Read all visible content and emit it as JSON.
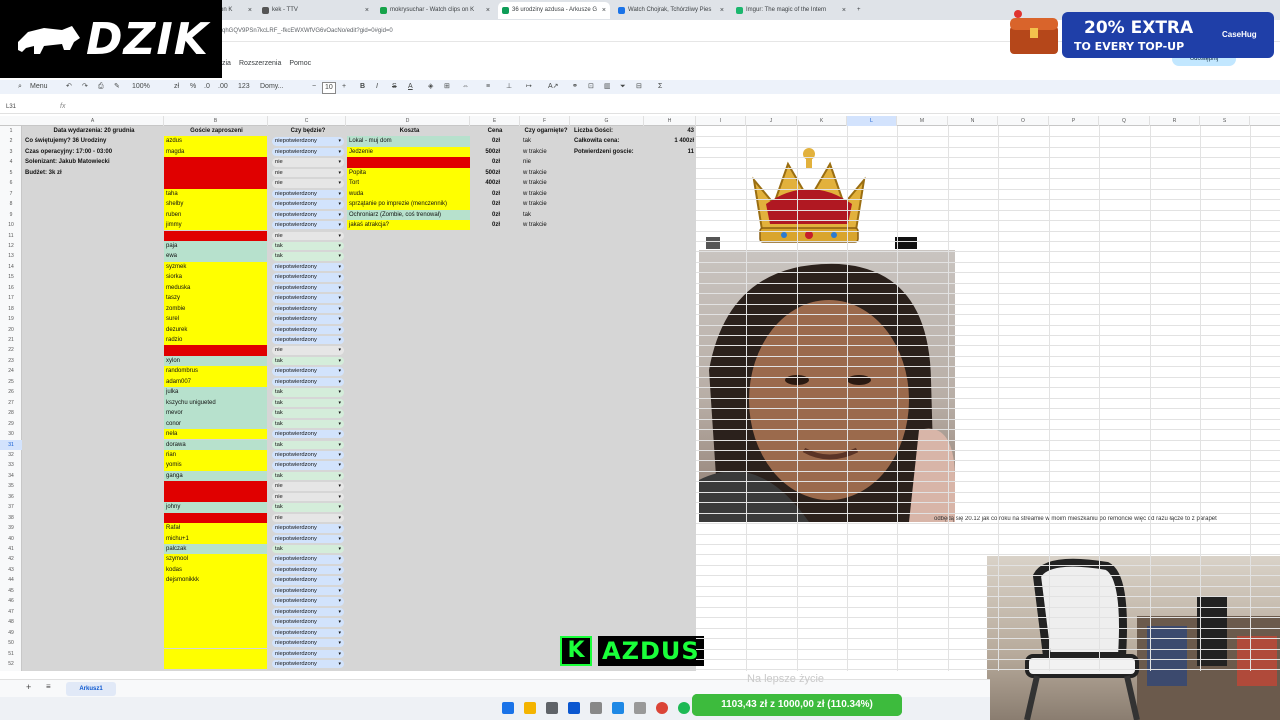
{
  "browser": {
    "tabs": [
      {
        "label": "on K",
        "color": "#888888"
      },
      {
        "label": "kek - TTV",
        "color": "#555555"
      },
      {
        "label": "mokrysuchar - Watch clips on K",
        "color": "#16a34a"
      },
      {
        "label": "36 urodziny azdusa - Arkusze G",
        "color": "#0f9d58",
        "active": true
      },
      {
        "label": "Watch Chojrak, Tchórzliwy Pies",
        "color": "#1a73e8"
      },
      {
        "label": "Imgur: The magic of the Intern",
        "color": "#1bb76e"
      }
    ],
    "new_tab": "+",
    "url": "qhGQV9PSn7kcLRF_-fkcEWXWfVG6vOacNo/edit?gid=0#gid=0"
  },
  "docs": {
    "menus": [
      "zia",
      "Rozszerzenia",
      "Pomoc"
    ],
    "share_label": "Udostępnij"
  },
  "toolbar": {
    "menu_label": "Menu",
    "zoom": "100%",
    "currency": "zł",
    "percent": "%",
    "dec_dec": ".0",
    "dec_inc": ".00",
    "number_fmt": "123",
    "font": "Domy...",
    "font_size": "10"
  },
  "formula": {
    "namebox": "L31",
    "fx": "fx"
  },
  "columns": [
    "A",
    "B",
    "C",
    "D",
    "E",
    "F",
    "G",
    "H",
    "I",
    "J",
    "K",
    "L",
    "M",
    "N",
    "O",
    "P",
    "Q",
    "R",
    "S"
  ],
  "selected_column": "L",
  "selected_row": 31,
  "row_count": 52,
  "headers": {
    "date": "Data wydarzenia: 20 grudnia",
    "guests": "Goście zaproszeni",
    "coming": "Czy będzie?",
    "costs": "Koszta",
    "price": "Cena",
    "handled": "Czy ogarnięte?",
    "guest_count_label": "Liczba Gości:",
    "guest_count_value": "43"
  },
  "info": [
    "Co świętujemy? 36 Urodziny",
    "Czas operacyjny: 17:00 - 03:00",
    "Solenizant: Jakub Matowiecki",
    "Budżet: 3k zł"
  ],
  "summary": [
    {
      "label": "Całkowita cena:",
      "value": "1 400zł"
    },
    {
      "label": "Potwierdzeni goscie:",
      "value": "11"
    }
  ],
  "guests": [
    {
      "name": "azdus",
      "status": "niepotwierdzony",
      "color": "yellow"
    },
    {
      "name": "magda",
      "status": "niepotwierdzony",
      "color": "yellow"
    },
    {
      "name": "",
      "status": "nie",
      "color": "red"
    },
    {
      "name": "",
      "status": "nie",
      "color": "red"
    },
    {
      "name": "",
      "status": "nie",
      "color": "red"
    },
    {
      "name": "taha",
      "status": "niepotwierdzony",
      "color": "yellow"
    },
    {
      "name": "shelby",
      "status": "niepotwierdzony",
      "color": "yellow"
    },
    {
      "name": "ruben",
      "status": "niepotwierdzony",
      "color": "yellow"
    },
    {
      "name": "jimmy",
      "status": "niepotwierdzony",
      "color": "yellow"
    },
    {
      "name": "",
      "status": "nie",
      "color": "red"
    },
    {
      "name": "paja",
      "status": "tak",
      "color": "green"
    },
    {
      "name": "ewa",
      "status": "tak",
      "color": "green"
    },
    {
      "name": "syzmek",
      "status": "niepotwierdzony",
      "color": "yellow"
    },
    {
      "name": "siorka",
      "status": "niepotwierdzony",
      "color": "yellow"
    },
    {
      "name": "meduska",
      "status": "niepotwierdzony",
      "color": "yellow"
    },
    {
      "name": "taszy",
      "status": "niepotwierdzony",
      "color": "yellow"
    },
    {
      "name": "zombie",
      "status": "niepotwierdzony",
      "color": "yellow"
    },
    {
      "name": "surel",
      "status": "niepotwierdzony",
      "color": "yellow"
    },
    {
      "name": "dezurek",
      "status": "niepotwierdzony",
      "color": "yellow"
    },
    {
      "name": "radzio",
      "status": "niepotwierdzony",
      "color": "yellow"
    },
    {
      "name": "",
      "status": "nie",
      "color": "red"
    },
    {
      "name": "xylon",
      "status": "tak",
      "color": "green"
    },
    {
      "name": "randombrus",
      "status": "niepotwierdzony",
      "color": "yellow"
    },
    {
      "name": "adam007",
      "status": "niepotwierdzony",
      "color": "yellow"
    },
    {
      "name": "julka",
      "status": "tak",
      "color": "green"
    },
    {
      "name": "kszychu unigueted",
      "status": "tak",
      "color": "green"
    },
    {
      "name": "mevor",
      "status": "tak",
      "color": "green"
    },
    {
      "name": "conor",
      "status": "tak",
      "color": "green"
    },
    {
      "name": "nela",
      "status": "niepotwierdzony",
      "color": "yellow"
    },
    {
      "name": "dorawa",
      "status": "tak",
      "color": "green"
    },
    {
      "name": "rian",
      "status": "niepotwierdzony",
      "color": "yellow"
    },
    {
      "name": "yomis",
      "status": "niepotwierdzony",
      "color": "yellow"
    },
    {
      "name": "ganga",
      "status": "tak",
      "color": "green"
    },
    {
      "name": "",
      "status": "nie",
      "color": "red"
    },
    {
      "name": "",
      "status": "nie",
      "color": "red"
    },
    {
      "name": "johny",
      "status": "tak",
      "color": "green"
    },
    {
      "name": "",
      "status": "nie",
      "color": "red"
    },
    {
      "name": "Rafał",
      "status": "niepotwierdzony",
      "color": "yellow"
    },
    {
      "name": "michu+1",
      "status": "niepotwierdzony",
      "color": "yellow"
    },
    {
      "name": "palczak",
      "status": "tak",
      "color": "green"
    },
    {
      "name": "szymool",
      "status": "niepotwierdzony",
      "color": "yellow"
    },
    {
      "name": "kodas",
      "status": "niepotwierdzony",
      "color": "yellow"
    },
    {
      "name": "dejsmonikkk",
      "status": "niepotwierdzony",
      "color": "yellow"
    },
    {
      "name": "",
      "status": "niepotwierdzony",
      "color": "yellow"
    },
    {
      "name": "",
      "status": "niepotwierdzony",
      "color": "yellow"
    },
    {
      "name": "",
      "status": "niepotwierdzony",
      "color": "yellow"
    },
    {
      "name": "",
      "status": "niepotwierdzony",
      "color": "yellow"
    },
    {
      "name": "",
      "status": "niepotwierdzony",
      "color": "yellow"
    },
    {
      "name": "",
      "status": "niepotwierdzony",
      "color": "yellow"
    },
    {
      "name": "",
      "status": "niepotwierdzony",
      "color": "yellow"
    },
    {
      "name": "",
      "status": "niepotwierdzony",
      "color": "yellow"
    }
  ],
  "costs": [
    {
      "item": "Lokal - muj dom",
      "price": "0zł",
      "handled": "tak",
      "color": "green"
    },
    {
      "item": "Jedzenie",
      "price": "500zł",
      "handled": "w trakcie",
      "color": "yellow"
    },
    {
      "item": "",
      "price": "0zł",
      "handled": "nie",
      "color": "red"
    },
    {
      "item": "Popita",
      "price": "500zł",
      "handled": "w trakcie",
      "color": "yellow"
    },
    {
      "item": "Tort",
      "price": "400zł",
      "handled": "w trakcie",
      "color": "yellow"
    },
    {
      "item": "wuda",
      "price": "0zł",
      "handled": "w trakcie",
      "color": "yellow"
    },
    {
      "item": "sprzątanie po imprezie (menczennik)",
      "price": "0zł",
      "handled": "w trakcie",
      "color": "yellow"
    },
    {
      "item": "Ochroniarz (Zombie, coś trenował)",
      "price": "0zł",
      "handled": "tak",
      "color": "green"
    },
    {
      "item": "jakaś atrakcja?",
      "price": "0zł",
      "handled": "w trakcie",
      "color": "yellow"
    }
  ],
  "colors": {
    "yellow": "#ffff00",
    "red": "#e00000",
    "green": "#b7e1cd",
    "chip_yellow": "#d2e3fc",
    "chip_green": "#d4edda",
    "chip_red": "#e6e6e6"
  },
  "overlays": {
    "dzik_brand": "DZIK",
    "dzik_reg": "®",
    "promo_line1": "20% EXTRA",
    "promo_line2": "TO EVERY TOP-UP",
    "promo_brand": "CaseHug",
    "ticker": "odbędą się 20.12 jak co roku na streamie w moim mieszkaniu po remoncie więc od razu łącze to z parapet",
    "name_tag_initial": "K",
    "name_tag": "AZDUS",
    "caption": "Na lepsze życie",
    "donation": "1103,43 zł z 1000,00 zł (110.34%)",
    "donation_fraction": 1.0
  },
  "sheet_tabs": {
    "add": "+",
    "all": "≡",
    "active": "Arkusz1"
  }
}
